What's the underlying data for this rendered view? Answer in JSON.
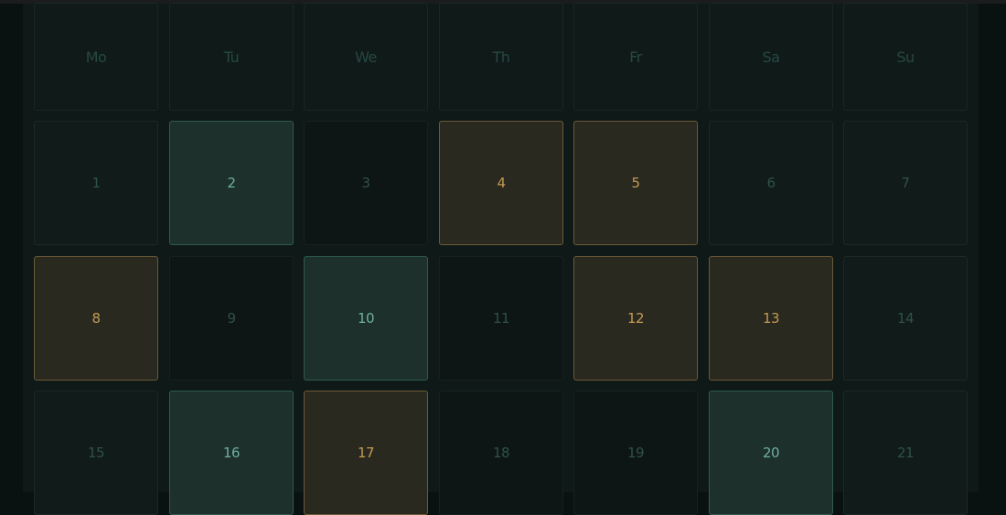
{
  "weekdays": [
    "Mo",
    "Tu",
    "We",
    "Th",
    "Fr",
    "Sa",
    "Su"
  ],
  "weeks": [
    [
      {
        "day": "1",
        "state": "normal"
      },
      {
        "day": "2",
        "state": "green"
      },
      {
        "day": "3",
        "state": "empty"
      },
      {
        "day": "4",
        "state": "amber"
      },
      {
        "day": "5",
        "state": "amber"
      },
      {
        "day": "6",
        "state": "normal"
      },
      {
        "day": "7",
        "state": "normal"
      }
    ],
    [
      {
        "day": "8",
        "state": "amber"
      },
      {
        "day": "9",
        "state": "empty"
      },
      {
        "day": "10",
        "state": "green"
      },
      {
        "day": "11",
        "state": "empty"
      },
      {
        "day": "12",
        "state": "amber"
      },
      {
        "day": "13",
        "state": "amber"
      },
      {
        "day": "14",
        "state": "normal"
      }
    ],
    [
      {
        "day": "15",
        "state": "normal"
      },
      {
        "day": "16",
        "state": "green"
      },
      {
        "day": "17",
        "state": "amber"
      },
      {
        "day": "18",
        "state": "empty"
      },
      {
        "day": "19",
        "state": "empty"
      },
      {
        "day": "20",
        "state": "green"
      },
      {
        "day": "21",
        "state": "normal"
      }
    ]
  ],
  "colors": {
    "background": "#0a1211",
    "panel": "#0f1917",
    "green_fill": "#1d302c",
    "green_text": "#6fb09e",
    "amber_fill": "#2a2920",
    "amber_text": "#c39a55",
    "muted_text": "#2f5149"
  }
}
